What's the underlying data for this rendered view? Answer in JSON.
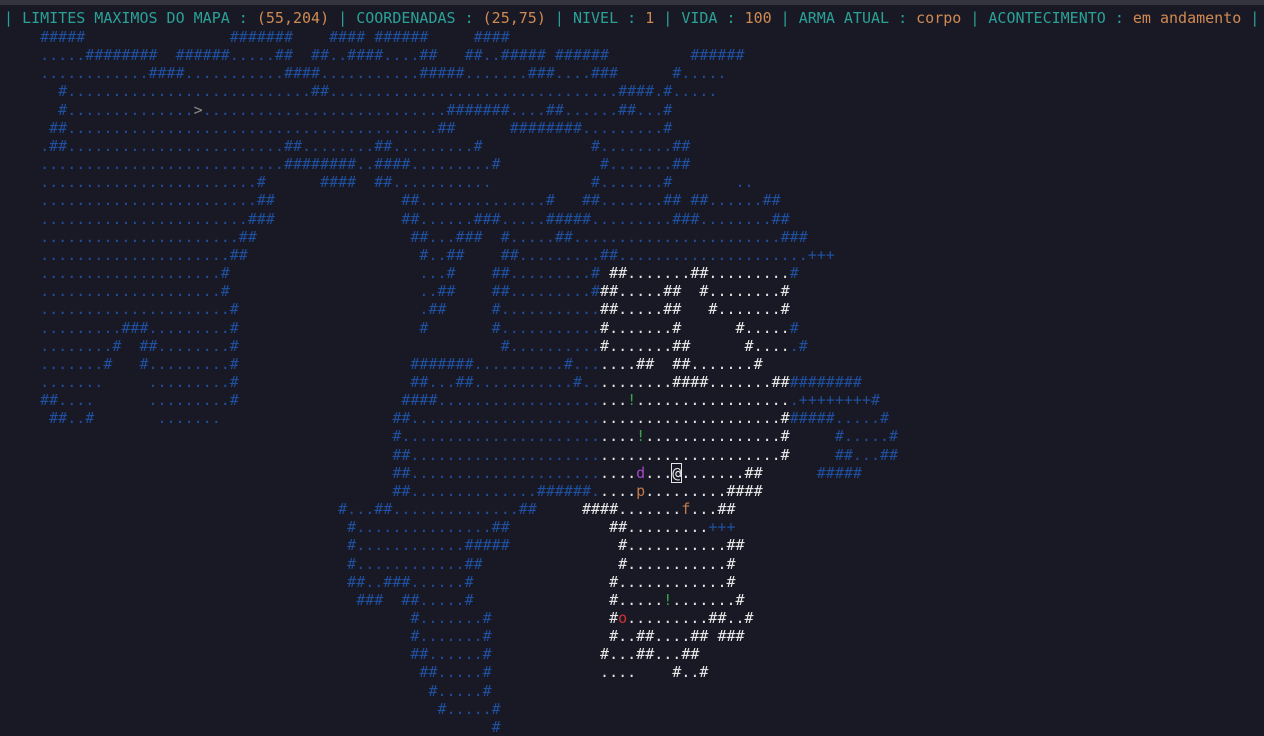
{
  "status": {
    "max_label": "LIMITES MAXIMOS DO MAPA : ",
    "max_value": "(55,204)",
    "coord_label": "COORDENADAS : ",
    "coord_value": "(25,75)",
    "level_label": "NIVEL : ",
    "level_value": "1",
    "life_label": "VIDA : ",
    "life_value": "100",
    "weapon_label": "ARMA ATUAL : ",
    "weapon_value": "corpo",
    "event_label": "ACONTECIMENTO : ",
    "event_value": "em andamento"
  },
  "colors": {
    "background": "#191925",
    "status_label": "#2aa198",
    "status_value": "#d08a52",
    "explored_map": "#1f4f9e",
    "visible_map": "#e6e6e6",
    "potion": "#3aa24a",
    "enemy_d": "#a248c8",
    "enemy_o": "#d23232",
    "item_p_f": "#c07a4a"
  },
  "map_rows": [
    "    #####                #######    #### ######     ####",
    "    .....########  ######.....##  ##..####....##   ##..##### ######         ######",
    "    ............####...........####...........#####.......###....###      #.....",
    "      #...........................##................................####.#.....",
    "      #..............>...........................#######....##......##...#",
    "     ##.........................................##      ########.........#",
    "    .##........................##........##.........#            #........##",
    "    ...........................########..####.........#           #.......##",
    "    ........................#      ####  ##...........           #.......#       ..",
    "    ........................##              ##..............#   ##.......## ##......##",
    "    .......................###              ##......###.....#####.........###........##",
    "    ......................##                 ##...###  #.....##.......................###",
    "    .....................##                   #..##    ##.........##.....................+++",
    "    ....................#                     ...#    ##.........# ##.......##.........#",
    "    ....................#                     ..##    ##.........###.....##  #........#",
    "    .....................#                    .##     #...........##.....##   #.......#",
    "    .........###.........#                    #       #...........#.......#      #.....#",
    "    ........#  ##........#                             #..........#.......##      #.....#",
    "    .......#   #.........#                   #######..........#.......##  ##.......#",
    "    .......     .........#                   ##...##...........#..........####.......##########",
    "    ##....      .........#                  ####.....................!..................++++++++#",
    "     ##..#       .......                   ##.........................................######.....#",
    "                                           #..........................!...............#     #.....#",
    "                                           ##.........................................#     ##...##",
    "                                           ##.........................d...@.......##      #####",
    "                                           ##..............######.....p.........####",
    "                                     #...##..............##     ####.......f...##",
    "                                      #...............##           ##.........+++",
    "                                      #............#####            #...........##",
    "                                      #............##               #...........#",
    "                                      ##..###......#               #............#",
    "                                       ###  ##.....#               #.....!.......#",
    "                                             #.......#             #o.........##..#",
    "                                             #.......#             #..##....## ###",
    "                                             ##......#            #...##...##",
    "                                              ##.....#            ....    #..#",
    "                                               #.....#",
    "                                                #.....#",
    "                                                      #"
  ]
}
